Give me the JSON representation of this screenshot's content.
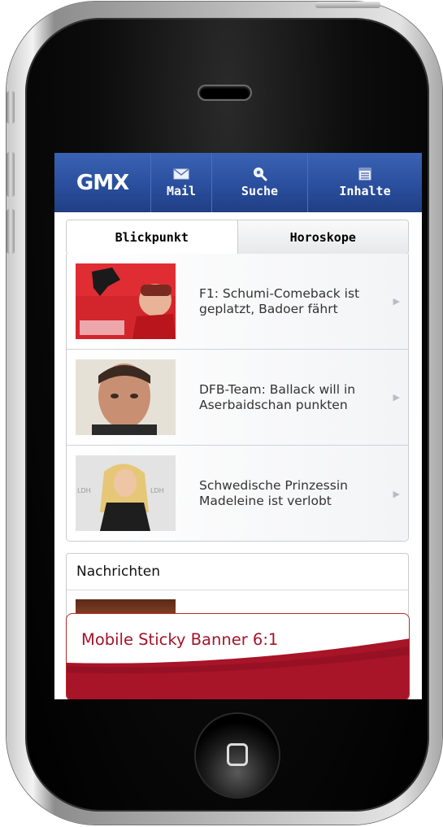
{
  "navbar": {
    "logo": "GMX",
    "items": [
      {
        "label": "Mail",
        "icon": "envelope-icon"
      },
      {
        "label": "Suche",
        "icon": "search-icon"
      },
      {
        "label": "Inhalte",
        "icon": "list-icon"
      }
    ]
  },
  "tabs": [
    {
      "label": "Blickpunkt",
      "active": true
    },
    {
      "label": "Horoskope",
      "active": false
    }
  ],
  "news": [
    {
      "title": "F1: Schumi-Comeback ist geplatzt, Badoer fährt",
      "image": "driver-photo"
    },
    {
      "title": "DFB-Team: Ballack will in Aserbaidschan punkten",
      "image": "player-photo"
    },
    {
      "title": "Schwedische Prinzessin Madeleine ist verlobt",
      "image": "princess-photo"
    }
  ],
  "section": {
    "title": "Nachrichten"
  },
  "banner": {
    "text": "Mobile Sticky Banner 6:1"
  },
  "colors": {
    "nav_blue": "#2b4f9e",
    "banner_red": "#a3142a"
  }
}
